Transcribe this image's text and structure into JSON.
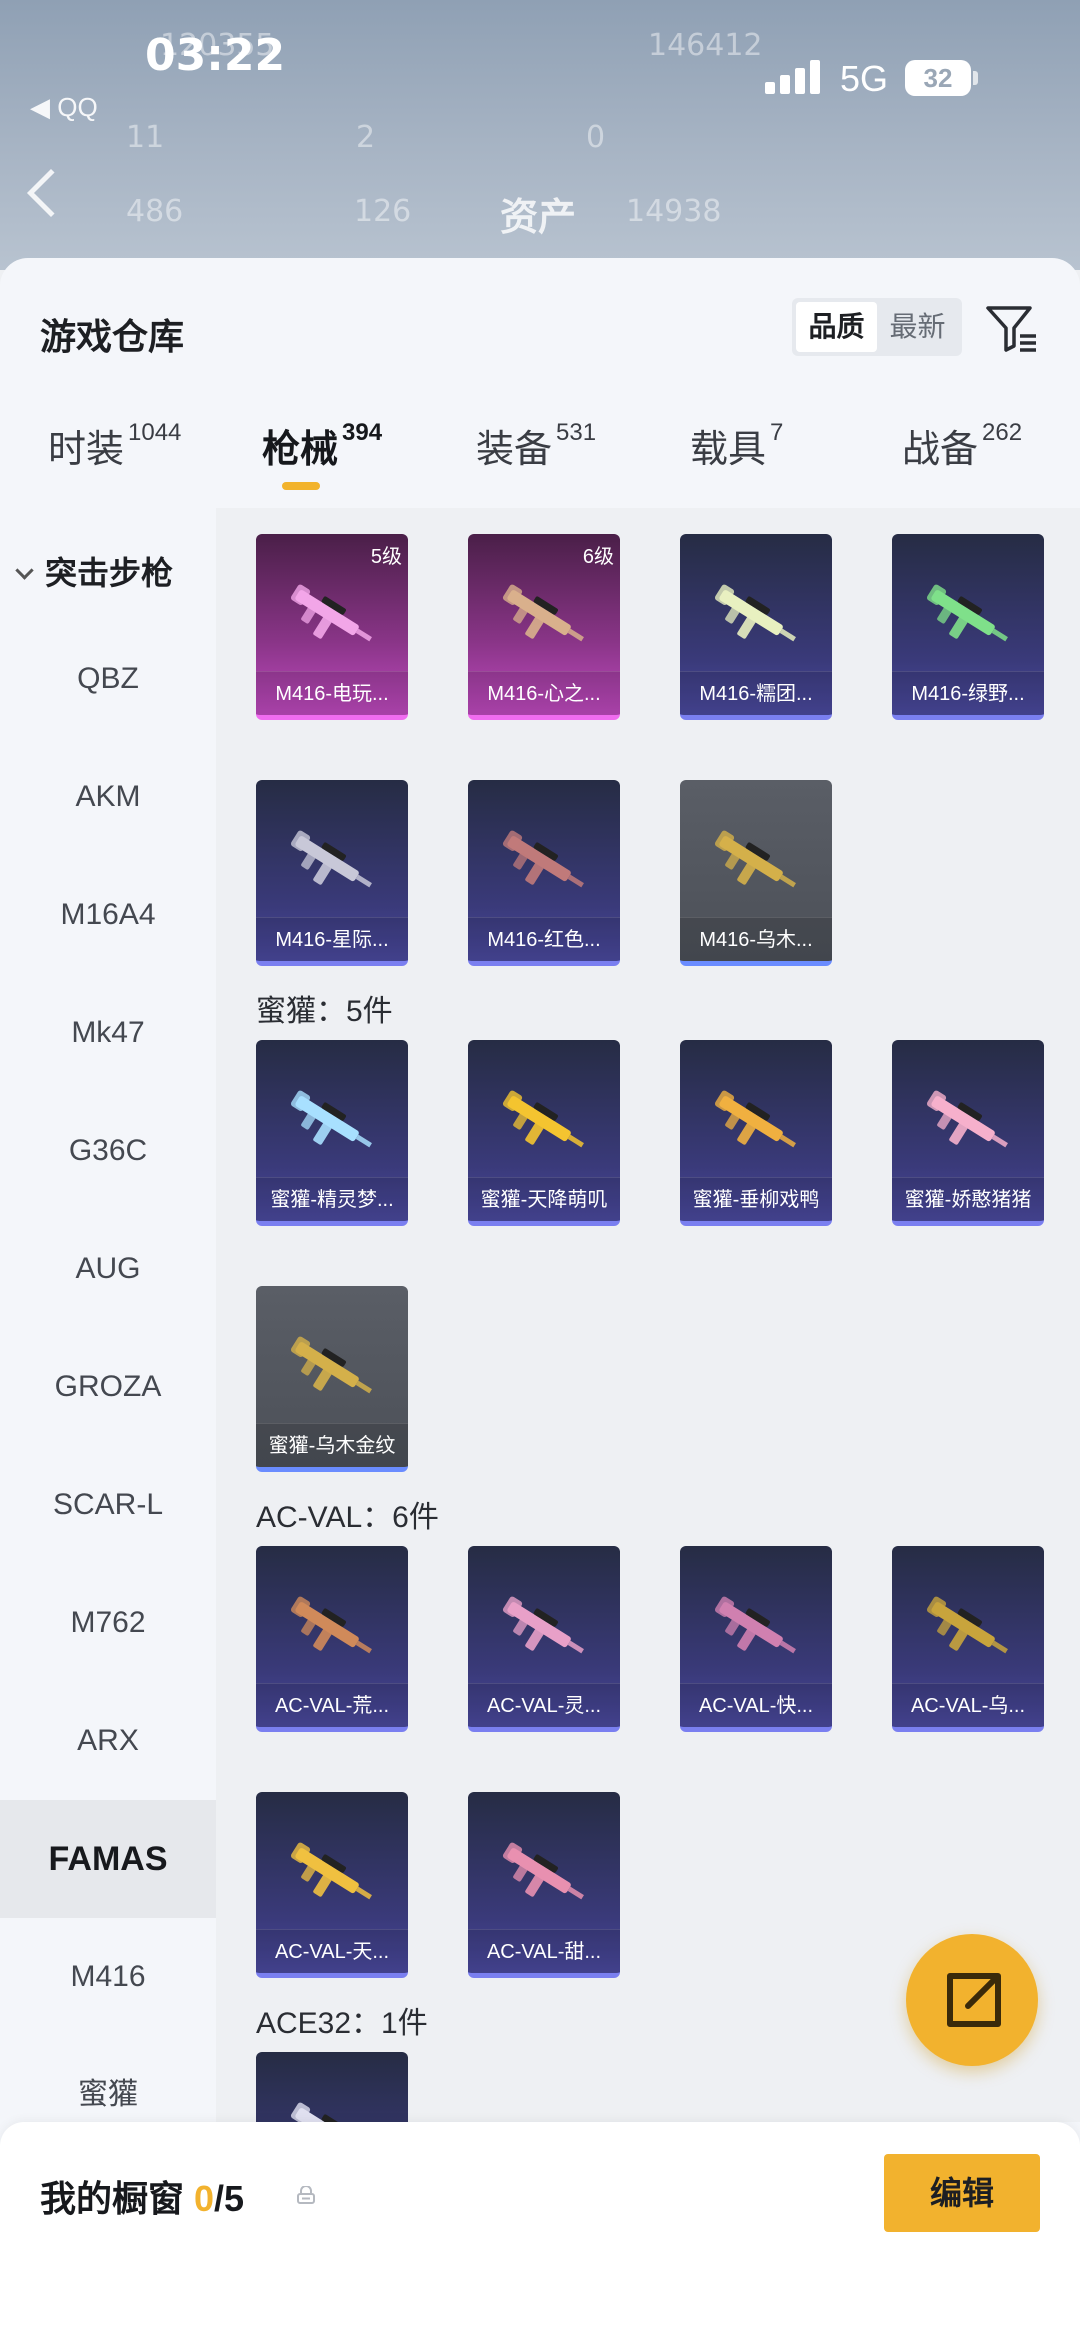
{
  "status_bar": {
    "time": "03:22",
    "back_app": "◀ QQ",
    "network": "5G",
    "battery": "32"
  },
  "bg_header": {
    "title": "资产",
    "values": [
      "120355",
      "146412",
      "11",
      "2",
      "0",
      "486",
      "126",
      "14938"
    ]
  },
  "sheet": {
    "title": "游戏仓库",
    "sort_options": [
      "品质",
      "最新"
    ],
    "active_sort": "品质"
  },
  "tabs": [
    {
      "label": "时装",
      "count": "1044"
    },
    {
      "label": "枪械",
      "count": "394"
    },
    {
      "label": "装备",
      "count": "531"
    },
    {
      "label": "载具",
      "count": "7"
    },
    {
      "label": "战备",
      "count": "262"
    }
  ],
  "sidebar": {
    "category": "突击步枪",
    "items": [
      "QBZ",
      "AKM",
      "M16A4",
      "Mk47",
      "G36C",
      "AUG",
      "GROZA",
      "SCAR-L",
      "M762",
      "ARX",
      "FAMAS",
      "M416",
      "蜜獾"
    ],
    "active": "FAMAS"
  },
  "sections": {
    "m416": [
      {
        "name": "M416-电玩...",
        "level": "5级",
        "rarity": "pink",
        "accent": "#f2a6e8"
      },
      {
        "name": "M416-心之...",
        "level": "6级",
        "rarity": "pink",
        "accent": "#d9b08c"
      },
      {
        "name": "M416-糯团...",
        "level": "",
        "rarity": "purple",
        "accent": "#e8f0c0"
      },
      {
        "name": "M416-绿野...",
        "level": "",
        "rarity": "purple",
        "accent": "#7fe08a"
      },
      {
        "name": "M416-星际...",
        "level": "",
        "rarity": "purple",
        "accent": "#c8c8d8"
      },
      {
        "name": "M416-红色...",
        "level": "",
        "rarity": "purple",
        "accent": "#c07a7a"
      },
      {
        "name": "M416-乌木...",
        "level": "",
        "rarity": "gray",
        "accent": "#d4b04a"
      }
    ],
    "honey_badger": {
      "label": "蜜獾：5件",
      "items": [
        {
          "name": "蜜獾-精灵梦...",
          "rarity": "purple",
          "accent": "#a8e0ff"
        },
        {
          "name": "蜜獾-天降萌叽",
          "rarity": "purple",
          "accent": "#f4c430"
        },
        {
          "name": "蜜獾-垂柳戏鸭",
          "rarity": "purple",
          "accent": "#f0b040"
        },
        {
          "name": "蜜獾-娇憨猪猪",
          "rarity": "purple",
          "accent": "#f6b0cc"
        },
        {
          "name": "蜜獾-乌木金纹",
          "rarity": "gray",
          "accent": "#d4b04a"
        }
      ]
    },
    "ac_val": {
      "label": "AC-VAL：6件",
      "items": [
        {
          "name": "AC-VAL-荒...",
          "rarity": "purple",
          "accent": "#d08a5a"
        },
        {
          "name": "AC-VAL-灵...",
          "rarity": "purple",
          "accent": "#e8a0c8"
        },
        {
          "name": "AC-VAL-快...",
          "rarity": "purple",
          "accent": "#d080b0"
        },
        {
          "name": "AC-VAL-乌...",
          "rarity": "purple",
          "accent": "#c8a43c"
        },
        {
          "name": "AC-VAL-天...",
          "rarity": "purple",
          "accent": "#f0c040"
        },
        {
          "name": "AC-VAL-甜...",
          "rarity": "purple",
          "accent": "#e890b0"
        }
      ]
    },
    "ace32": {
      "label": "ACE32：1件",
      "items": [
        {
          "name": "",
          "rarity": "purple",
          "accent": "#e0e0f0"
        }
      ]
    }
  },
  "showcase": {
    "label": "我的橱窗",
    "count": "0",
    "total": "/5"
  },
  "edit_button": "编辑",
  "colors": {
    "accent": "#f2b22e",
    "purple_rarity": "#7a7ff0",
    "pink_rarity": "#f06cf0"
  }
}
